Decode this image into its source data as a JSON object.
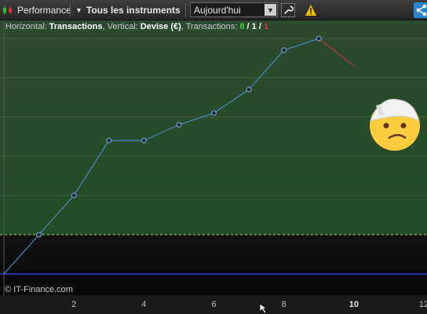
{
  "toolbar": {
    "performance_label": "Performance",
    "instruments_label": "Tous les instruments",
    "period_value": "Aujourd'hui",
    "icons": [
      "candlestick-icon",
      "caret-down-icon",
      "chevron-down-icon",
      "wrench-icon",
      "warning-icon",
      "share-icon"
    ],
    "warning_color": "#f0c000",
    "share_color": "#2a86c8"
  },
  "subtitle": {
    "horizontal_label": "Horizontal: ",
    "horizontal_value": "Transactions",
    "vertical_label": ", Vertical: ",
    "vertical_value": "Devise (€)",
    "transactions_label": ", Transactions: ",
    "count_green": "8",
    "slash1": " / ",
    "count_white": "1",
    "slash2": " / ",
    "count_red": "1"
  },
  "copyright": "© IT-Finance.com",
  "emoji_icon": "face-with-head-bandage-icon",
  "chart_data": {
    "type": "line",
    "x": [
      0,
      1,
      2,
      3,
      4,
      5,
      6,
      7,
      8,
      9,
      10
    ],
    "series": [
      {
        "values": [
          0,
          1,
          2,
          3.4,
          3.4,
          3.8,
          4.1,
          4.7,
          5.7,
          6,
          5.3
        ]
      }
    ],
    "win_color": "#4a86c8",
    "loss_color": "#b83a3a",
    "xlim": [
      0,
      12
    ],
    "xticks": [
      "2",
      "4",
      "6",
      "8",
      "10",
      "12"
    ],
    "highlight_tick": "10",
    "background_split_value": 1
  }
}
